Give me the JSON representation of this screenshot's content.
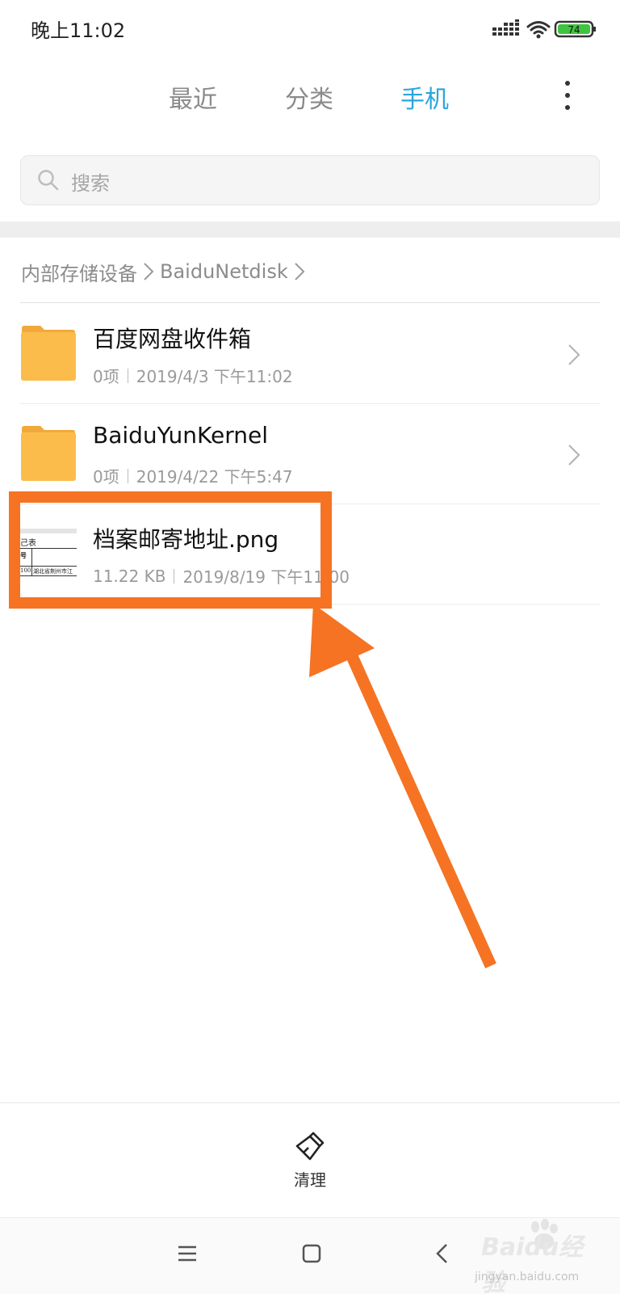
{
  "status_bar": {
    "time": "晚上11:02",
    "battery": "74",
    "battery_color": "#3ec43e"
  },
  "tabs": [
    {
      "label": "最近",
      "active": false
    },
    {
      "label": "分类",
      "active": false
    },
    {
      "label": "手机",
      "active": true
    }
  ],
  "accent_color": "#2aa5dd",
  "search": {
    "placeholder": "搜索"
  },
  "breadcrumb": [
    "内部存储设备",
    "BaiduNetdisk"
  ],
  "files": [
    {
      "name": "百度网盘收件箱",
      "count": "0项",
      "date": "2019/4/3 下午11:02",
      "type": "folder"
    },
    {
      "name": "BaiduYunKernel",
      "count": "0项",
      "date": "2019/4/22 下午5:47",
      "type": "folder"
    },
    {
      "name": "档案邮寄地址.png",
      "size": "11.22 KB",
      "date": "2019/8/19 下午11:00",
      "type": "image"
    }
  ],
  "thumbnail_text": {
    "title": "己表",
    "col": "号",
    "num": "100",
    "address": "湖北省荆州市江"
  },
  "folder_color": "#fcbc4b",
  "highlight_color": "#f57323",
  "toolbar": {
    "clean_label": "清理"
  },
  "watermark": {
    "brand": "Baidu经验",
    "url": "jingyan.baidu.com"
  }
}
